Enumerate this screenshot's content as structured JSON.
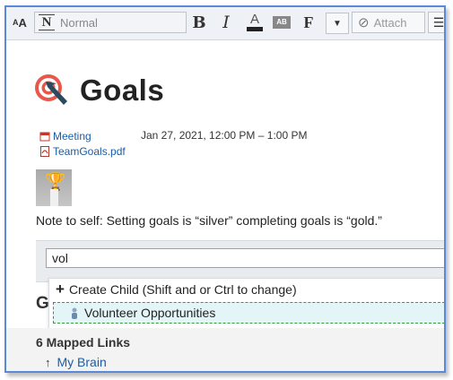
{
  "toolbar": {
    "font_size_icon": "font-size-icon",
    "style_value": "Normal",
    "bold_label": "B",
    "italic_label": "I",
    "text_color_label": "A",
    "highlight_label": "AB",
    "font_label": "F",
    "attach_label": "Attach"
  },
  "page": {
    "title": "Goals",
    "attachments": [
      {
        "label": "Meeting",
        "time": "Jan 27, 2021, 12:00 PM – 1:00 PM"
      },
      {
        "label": "TeamGoals.pdf"
      }
    ],
    "note": "Note to self:  Setting goals is “silver”  completing goals is “gold.”"
  },
  "search": {
    "value": "vol"
  },
  "section": {
    "partial_heading": "G"
  },
  "dropdown": {
    "create_label": "Create Child (Shift and or Ctrl to change)",
    "items": [
      {
        "label": "Volunteer Opportunities"
      }
    ]
  },
  "mapped": {
    "heading": "6 Mapped Links",
    "links": [
      {
        "label": "My Brain"
      }
    ]
  },
  "colors": {
    "link": "#1a5da6",
    "frame_border": "#5a8ad6",
    "highlight_row": "#e4f5f8",
    "highlight_border": "#3a9a3a"
  }
}
